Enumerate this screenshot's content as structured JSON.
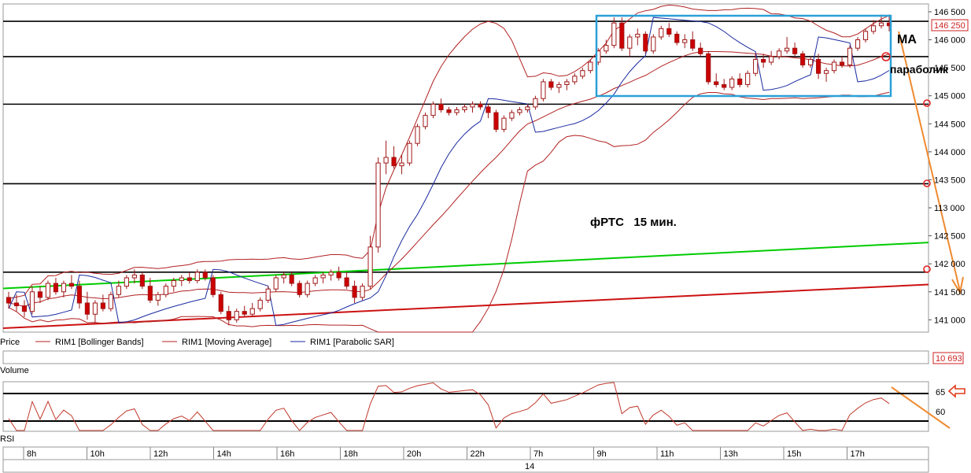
{
  "chart_data": {
    "type": "candlestick",
    "instrument_note": "фРТС   15 мин.",
    "annotations": {
      "ma": "MA",
      "parabolic": "параболик"
    },
    "legend": [
      "Price",
      "RIM1 [Bollinger Bands]",
      "RIM1 [Moving Average]",
      "RIM1 [Parabolic SAR]"
    ],
    "price_axis": {
      "ticks": [
        "146 500",
        "146 000",
        "145 500",
        "145 000",
        "144 500",
        "144 000",
        "143 500",
        "113 000",
        "142 500",
        "142 000",
        "141 500",
        "141 000"
      ],
      "last_price": "146 250"
    },
    "volume": {
      "label": "Volume",
      "last_value": "10 693"
    },
    "rsi": {
      "label": "RSI",
      "ticks": [
        "65",
        "60"
      ]
    },
    "time_axis": {
      "labels": [
        "8h",
        "10h",
        "12h",
        "14h",
        "16h",
        "18h",
        "20h",
        "22h",
        "7h",
        "9h",
        "11h",
        "13h",
        "15h",
        "17h"
      ],
      "date_label": "14"
    },
    "horizontal_levels": [
      146330,
      145700,
      144850,
      143430,
      141850
    ],
    "trend_lines": [
      {
        "color": "#00cc00",
        "from": [
          0,
          141560
        ],
        "to": [
          1,
          142380
        ]
      },
      {
        "color": "#cc1111",
        "from": [
          0,
          140850
        ],
        "to": [
          1,
          141630
        ]
      }
    ],
    "candles_ohlc": [
      [
        141400,
        141500,
        141200,
        141300
      ],
      [
        141300,
        141450,
        141150,
        141250
      ],
      [
        141250,
        141350,
        141050,
        141150
      ],
      [
        141150,
        141600,
        141100,
        141500
      ],
      [
        141500,
        141600,
        141300,
        141400
      ],
      [
        141400,
        141700,
        141350,
        141650
      ],
      [
        141650,
        141750,
        141450,
        141500
      ],
      [
        141500,
        141700,
        141400,
        141650
      ],
      [
        141650,
        141800,
        141550,
        141600
      ],
      [
        141600,
        141700,
        141200,
        141300
      ],
      [
        141300,
        141500,
        141000,
        141100
      ],
      [
        141100,
        141350,
        140950,
        141300
      ],
      [
        141300,
        141450,
        141150,
        141200
      ],
      [
        141200,
        141500,
        141150,
        141450
      ],
      [
        141450,
        141700,
        141400,
        141600
      ],
      [
        141600,
        141800,
        141550,
        141750
      ],
      [
        141750,
        141900,
        141650,
        141800
      ],
      [
        141800,
        141850,
        141550,
        141600
      ],
      [
        141600,
        141750,
        141300,
        141350
      ],
      [
        141350,
        141500,
        141250,
        141450
      ],
      [
        141450,
        141650,
        141400,
        141600
      ],
      [
        141600,
        141750,
        141500,
        141700
      ],
      [
        141700,
        141800,
        141600,
        141750
      ],
      [
        141750,
        141850,
        141650,
        141700
      ],
      [
        141700,
        141900,
        141650,
        141850
      ],
      [
        141850,
        141900,
        141700,
        141750
      ],
      [
        141750,
        141800,
        141400,
        141450
      ],
      [
        141450,
        141500,
        141100,
        141150
      ],
      [
        141150,
        141250,
        140900,
        141000
      ],
      [
        141000,
        141200,
        140950,
        141150
      ],
      [
        141150,
        141250,
        141050,
        141100
      ],
      [
        141100,
        141300,
        141050,
        141200
      ],
      [
        141200,
        141400,
        141150,
        141350
      ],
      [
        141350,
        141600,
        141300,
        141550
      ],
      [
        141550,
        141800,
        141500,
        141750
      ],
      [
        141750,
        141850,
        141650,
        141800
      ],
      [
        141800,
        141850,
        141600,
        141650
      ],
      [
        141650,
        141700,
        141400,
        141450
      ],
      [
        141450,
        141700,
        141400,
        141650
      ],
      [
        141650,
        141800,
        141600,
        141750
      ],
      [
        141750,
        141850,
        141650,
        141800
      ],
      [
        141800,
        141900,
        141700,
        141850
      ],
      [
        141850,
        141950,
        141700,
        141750
      ],
      [
        141750,
        141850,
        141550,
        141600
      ],
      [
        141600,
        141700,
        141300,
        141400
      ],
      [
        141400,
        141650,
        141350,
        141600
      ],
      [
        141600,
        142500,
        141550,
        142300
      ],
      [
        142300,
        143900,
        142200,
        143800
      ],
      [
        143800,
        144200,
        143600,
        143900
      ],
      [
        143900,
        144100,
        143700,
        143750
      ],
      [
        143750,
        143950,
        143600,
        143800
      ],
      [
        143800,
        144200,
        143750,
        144150
      ],
      [
        144150,
        144500,
        144100,
        144450
      ],
      [
        144450,
        144700,
        144400,
        144650
      ],
      [
        144650,
        144900,
        144600,
        144850
      ],
      [
        144850,
        144950,
        144700,
        144750
      ],
      [
        144750,
        144800,
        144650,
        144700
      ],
      [
        144700,
        144800,
        144650,
        144750
      ],
      [
        144750,
        144850,
        144700,
        144800
      ],
      [
        144800,
        144900,
        144700,
        144850
      ],
      [
        144850,
        144900,
        144750,
        144800
      ],
      [
        144800,
        144850,
        144600,
        144700
      ],
      [
        144700,
        144750,
        144350,
        144400
      ],
      [
        144400,
        144650,
        144350,
        144600
      ],
      [
        144600,
        144750,
        144550,
        144700
      ],
      [
        144700,
        144800,
        144650,
        144750
      ],
      [
        144750,
        144850,
        144700,
        144800
      ],
      [
        144800,
        145000,
        144750,
        144950
      ],
      [
        144950,
        145300,
        144900,
        145250
      ],
      [
        145250,
        145300,
        145100,
        145150
      ],
      [
        145150,
        145250,
        145050,
        145200
      ],
      [
        145200,
        145300,
        145100,
        145250
      ],
      [
        145250,
        145400,
        145200,
        145350
      ],
      [
        145350,
        145500,
        145300,
        145450
      ],
      [
        145450,
        145650,
        145400,
        145600
      ],
      [
        145600,
        145850,
        145550,
        145800
      ],
      [
        145800,
        146000,
        145750,
        145900
      ],
      [
        145900,
        146400,
        145850,
        146300
      ],
      [
        146300,
        146400,
        145800,
        145850
      ],
      [
        145850,
        146100,
        145700,
        146050
      ],
      [
        146050,
        146200,
        145900,
        146100
      ],
      [
        146100,
        146150,
        145750,
        145800
      ],
      [
        145800,
        146100,
        145750,
        146050
      ],
      [
        146050,
        146250,
        146000,
        146200
      ],
      [
        146200,
        146300,
        146050,
        146100
      ],
      [
        146100,
        146150,
        145900,
        145950
      ],
      [
        145950,
        146100,
        145850,
        146000
      ],
      [
        146000,
        146150,
        145800,
        145850
      ],
      [
        145850,
        145950,
        145700,
        145750
      ],
      [
        145750,
        145800,
        145200,
        145250
      ],
      [
        145250,
        145400,
        145150,
        145200
      ],
      [
        145200,
        145300,
        145100,
        145150
      ],
      [
        145150,
        145350,
        145100,
        145300
      ],
      [
        145300,
        145400,
        145150,
        145200
      ],
      [
        145200,
        145450,
        145150,
        145400
      ],
      [
        145400,
        145750,
        145350,
        145650
      ],
      [
        145650,
        145750,
        145500,
        145600
      ],
      [
        145600,
        145800,
        145550,
        145700
      ],
      [
        145700,
        145850,
        145650,
        145800
      ],
      [
        145800,
        146050,
        145750,
        145850
      ],
      [
        145850,
        145950,
        145700,
        145750
      ],
      [
        145750,
        145800,
        145500,
        145550
      ],
      [
        145550,
        145700,
        145500,
        145650
      ],
      [
        145650,
        145750,
        145300,
        145400
      ],
      [
        145400,
        145500,
        145250,
        145450
      ],
      [
        145450,
        145650,
        145400,
        145600
      ],
      [
        145600,
        145700,
        145500,
        145550
      ],
      [
        145550,
        145900,
        145500,
        145850
      ],
      [
        145850,
        146050,
        145800,
        146000
      ],
      [
        146000,
        146200,
        145950,
        146150
      ],
      [
        146150,
        146350,
        146100,
        146250
      ],
      [
        146250,
        146450,
        146200,
        146300
      ],
      [
        146300,
        146450,
        146150,
        146250
      ]
    ]
  }
}
